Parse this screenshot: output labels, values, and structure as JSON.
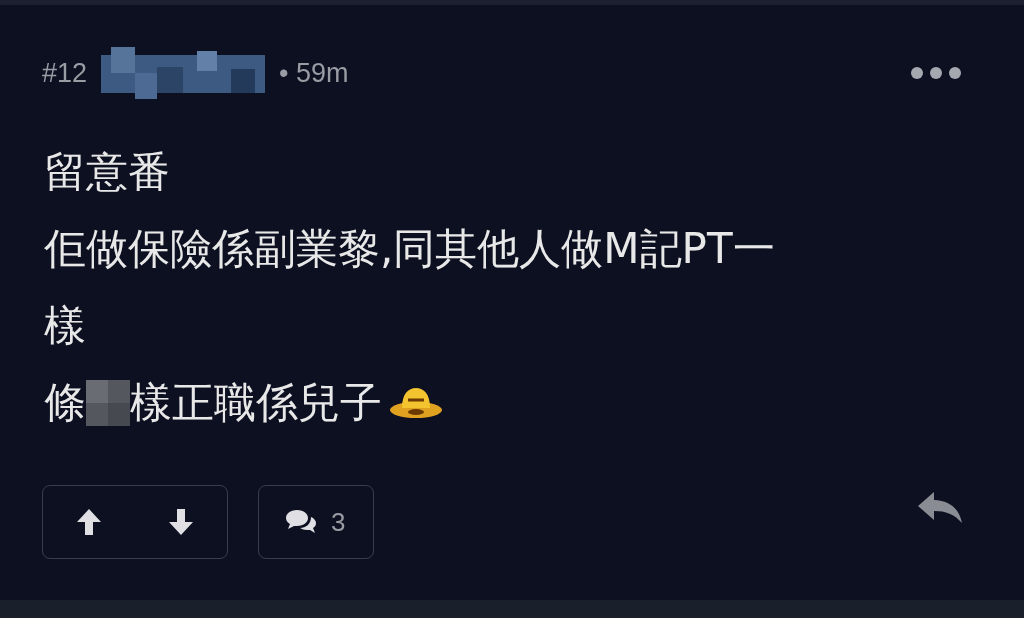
{
  "post": {
    "number": "#12",
    "time": "• 59m",
    "lines": [
      {
        "parts": [
          {
            "kind": "text",
            "text": "留意番"
          }
        ]
      },
      {
        "parts": [
          {
            "kind": "text",
            "text": "佢做保險係副業黎,同其他人做M記PT一"
          }
        ]
      },
      {
        "parts": [
          {
            "kind": "text",
            "text": "樣"
          }
        ]
      },
      {
        "parts": [
          {
            "kind": "text",
            "text": "條"
          },
          {
            "kind": "censor"
          },
          {
            "kind": "text",
            "text": "樣正職係兒子"
          },
          {
            "kind": "emoji"
          }
        ]
      }
    ],
    "comment_count": "3"
  }
}
